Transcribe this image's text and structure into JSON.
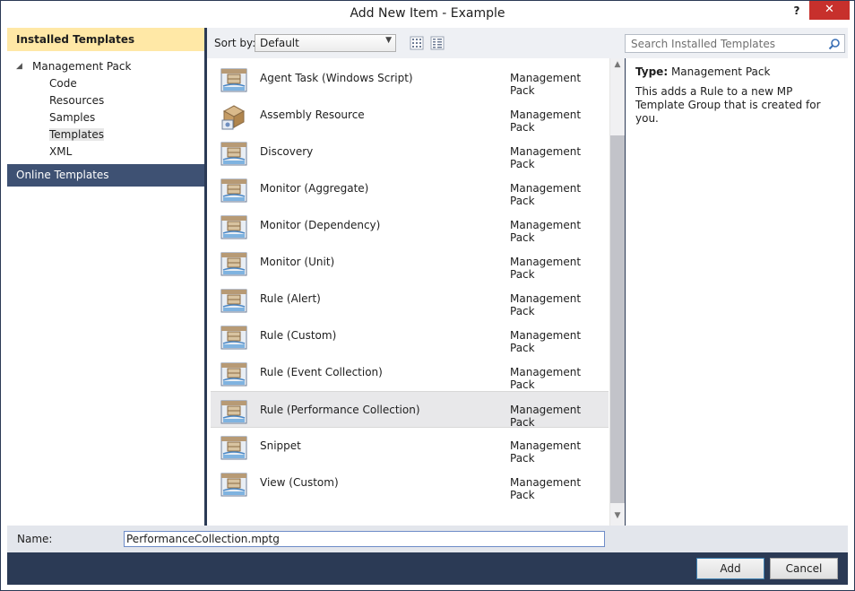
{
  "window": {
    "title": "Add New Item - Example",
    "help_label": "?",
    "close_label": "✕"
  },
  "left": {
    "installed_header": "Installed Templates",
    "root_label": "Management Pack",
    "root_arrow": "◢",
    "children": [
      "Code",
      "Resources",
      "Samples",
      "Templates",
      "XML"
    ],
    "selected_child": "Templates",
    "online_label": "Online Templates"
  },
  "toolbar": {
    "sort_label": "Sort by:",
    "sort_value": "Default",
    "search_placeholder": "Search Installed Templates"
  },
  "items": [
    {
      "name": "Agent Task (Windows Script)",
      "type": "Management Pack",
      "icon": "template-icon"
    },
    {
      "name": "Assembly Resource",
      "type": "Management Pack",
      "icon": "assembly-box-icon"
    },
    {
      "name": "Discovery",
      "type": "Management Pack",
      "icon": "template-icon"
    },
    {
      "name": "Monitor (Aggregate)",
      "type": "Management Pack",
      "icon": "template-icon"
    },
    {
      "name": "Monitor (Dependency)",
      "type": "Management Pack",
      "icon": "template-icon"
    },
    {
      "name": "Monitor (Unit)",
      "type": "Management Pack",
      "icon": "template-icon"
    },
    {
      "name": "Rule (Alert)",
      "type": "Management Pack",
      "icon": "template-icon"
    },
    {
      "name": "Rule (Custom)",
      "type": "Management Pack",
      "icon": "template-icon"
    },
    {
      "name": "Rule (Event Collection)",
      "type": "Management Pack",
      "icon": "template-icon"
    },
    {
      "name": "Rule (Performance Collection)",
      "type": "Management Pack",
      "icon": "template-icon",
      "selected": true
    },
    {
      "name": "Snippet",
      "type": "Management Pack",
      "icon": "template-icon"
    },
    {
      "name": "View (Custom)",
      "type": "Management Pack",
      "icon": "template-icon"
    }
  ],
  "details": {
    "type_label": "Type:",
    "type_value": "Management Pack",
    "description": "This adds a Rule to a new MP Template Group that is created for you."
  },
  "bottom": {
    "name_label": "Name:",
    "name_value": "PerformanceCollection.mptg",
    "add_label": "Add",
    "cancel_label": "Cancel"
  },
  "colors": {
    "frame": "#2b3a55",
    "installed_header_bg": "#ffe8a6",
    "online_bg": "#3e5173",
    "close_red": "#c7302c"
  }
}
